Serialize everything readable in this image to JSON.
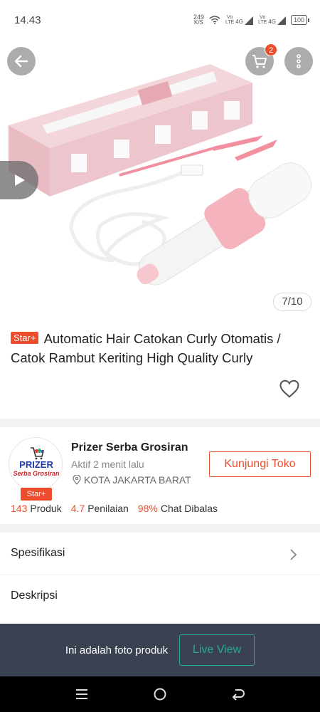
{
  "status_bar": {
    "time": "14.43",
    "net_speed_value": "249",
    "net_speed_unit": "K/S",
    "sim1_label_top": "Vo",
    "sim1_label_bottom": "LTE",
    "sim1_network": "4G",
    "sim2_label_top": "Vo",
    "sim2_label_bottom": "LTE",
    "sim2_network": "4G",
    "battery": "100"
  },
  "header": {
    "cart_count": "2",
    "image_counter": "7/10",
    "icons": [
      "back-arrow-icon",
      "cart-icon",
      "more-vertical-icon",
      "play-icon"
    ]
  },
  "product": {
    "badge": "Star+",
    "title": "Automatic Hair Catokan Curly Otomatis / Catok Rambut Keriting High Quality Curly"
  },
  "shop": {
    "logo_text_1": "PRIZER",
    "logo_text_2": "Serba Grosiran",
    "logo_badge": "Star+",
    "name": "Prizer Serba Grosiran",
    "active_status": "Aktif 2 menit lalu",
    "location": "KOTA JAKARTA BARAT",
    "visit_button": "Kunjungi Toko",
    "stats": {
      "products_value": "143",
      "products_label": "Produk",
      "rating_value": "4.7",
      "rating_label": "Penilaian",
      "chat_value": "98%",
      "chat_label": "Chat Dibalas"
    }
  },
  "sections": {
    "spec_label": "Spesifikasi",
    "desc_label": "Deskripsi"
  },
  "live_banner": {
    "text": "Ini adalah foto produk",
    "button": "Live View"
  },
  "colors": {
    "accent": "#ee4d2d",
    "teal": "#26aa99",
    "banner_bg": "#3a4150"
  }
}
